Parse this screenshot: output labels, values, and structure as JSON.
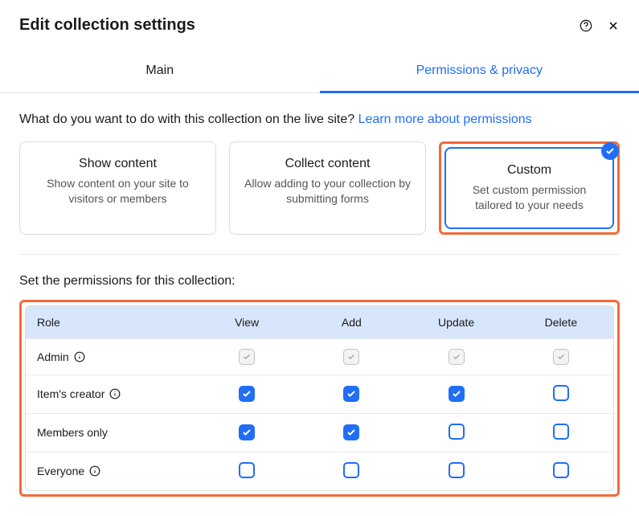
{
  "header": {
    "title": "Edit collection settings"
  },
  "tabs": {
    "main": "Main",
    "permissions": "Permissions & privacy"
  },
  "prompt": {
    "question": "What do you want to do with this collection on the live site? ",
    "link": "Learn more about permissions"
  },
  "cards": {
    "show": {
      "title": "Show content",
      "desc": "Show content on your site to visitors or members"
    },
    "collect": {
      "title": "Collect content",
      "desc": "Allow adding to your collection by submitting forms"
    },
    "custom": {
      "title": "Custom",
      "desc": "Set custom permission tailored to your needs"
    }
  },
  "permissions": {
    "section_label": "Set the permissions for this collection:",
    "columns": {
      "role": "Role",
      "view": "View",
      "add": "Add",
      "update": "Update",
      "delete": "Delete"
    },
    "rows": [
      {
        "role": "Admin",
        "info": true,
        "view": "locked",
        "add": "locked",
        "update": "locked",
        "delete": "locked"
      },
      {
        "role": "Item's creator",
        "info": true,
        "view": "checked",
        "add": "checked",
        "update": "checked",
        "delete": "unchecked"
      },
      {
        "role": "Members only",
        "info": false,
        "view": "checked",
        "add": "checked",
        "update": "unchecked",
        "delete": "unchecked"
      },
      {
        "role": "Everyone",
        "info": true,
        "view": "unchecked",
        "add": "unchecked",
        "update": "unchecked",
        "delete": "unchecked"
      }
    ]
  }
}
